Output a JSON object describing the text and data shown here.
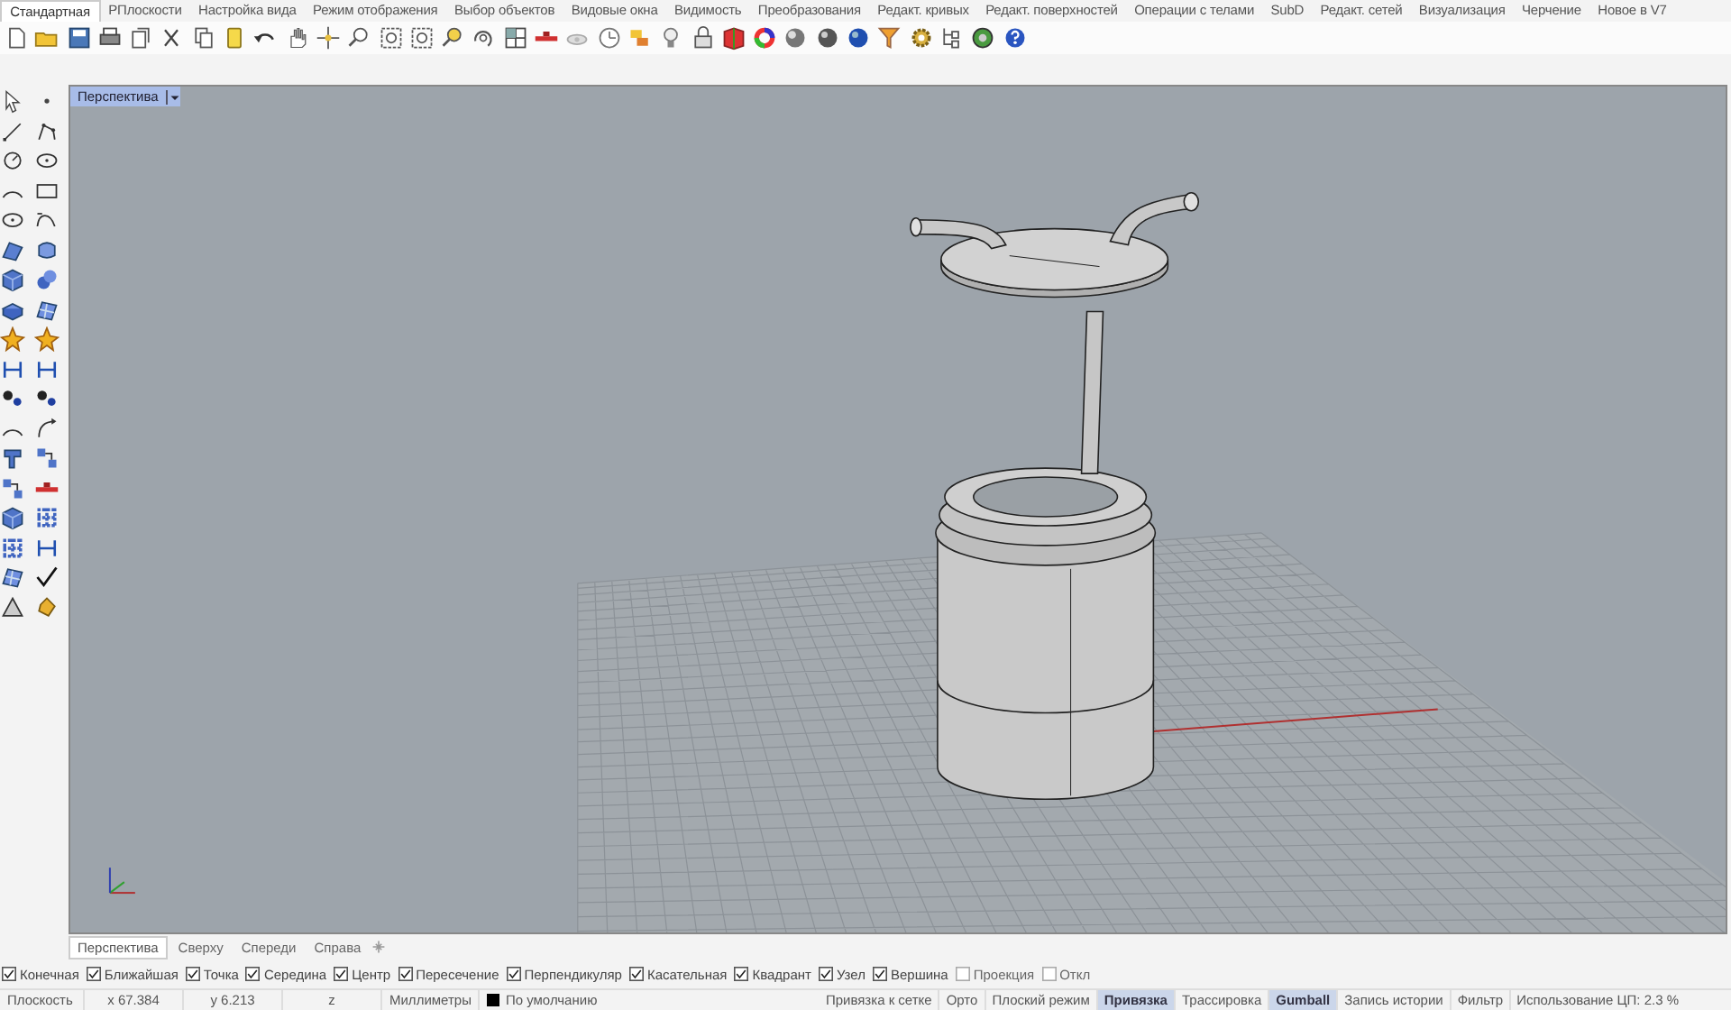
{
  "toolbar_tabs": [
    {
      "label": "Стандартная",
      "selected": true
    },
    {
      "label": "РПлоскости",
      "selected": false
    },
    {
      "label": "Настройка вида",
      "selected": false
    },
    {
      "label": "Режим отображения",
      "selected": false
    },
    {
      "label": "Выбор объектов",
      "selected": false
    },
    {
      "label": "Видовые окна",
      "selected": false
    },
    {
      "label": "Видимость",
      "selected": false
    },
    {
      "label": "Преобразования",
      "selected": false
    },
    {
      "label": "Редакт. кривых",
      "selected": false
    },
    {
      "label": "Редакт. поверхностей",
      "selected": false
    },
    {
      "label": "Операции с телами",
      "selected": false
    },
    {
      "label": "SubD",
      "selected": false
    },
    {
      "label": "Редакт. сетей",
      "selected": false
    },
    {
      "label": "Визуализация",
      "selected": false
    },
    {
      "label": "Черчение",
      "selected": false
    },
    {
      "label": "Новое в V7",
      "selected": false
    }
  ],
  "viewport": {
    "title": "Перспектива"
  },
  "view_tabs": [
    {
      "label": "Перспектива",
      "selected": true
    },
    {
      "label": "Сверху",
      "selected": false
    },
    {
      "label": "Спереди",
      "selected": false
    },
    {
      "label": "Справа",
      "selected": false
    }
  ],
  "osnaps": [
    {
      "label": "Конечная",
      "checked": true
    },
    {
      "label": "Ближайшая",
      "checked": true
    },
    {
      "label": "Точка",
      "checked": true
    },
    {
      "label": "Середина",
      "checked": true
    },
    {
      "label": "Центр",
      "checked": true
    },
    {
      "label": "Пересечение",
      "checked": true
    },
    {
      "label": "Перпендикуляр",
      "checked": true
    },
    {
      "label": "Касательная",
      "checked": true
    },
    {
      "label": "Квадрант",
      "checked": true
    },
    {
      "label": "Узел",
      "checked": true
    },
    {
      "label": "Вершина",
      "checked": true
    },
    {
      "label": "Проекция",
      "checked": false
    },
    {
      "label": "Откл",
      "checked": false
    }
  ],
  "status_bar": {
    "plane": "Плоскость",
    "x": "x 67.384",
    "y": "y 6.213",
    "z": "z",
    "units": "Миллиметры",
    "layer": {
      "name": "По умолчанию",
      "color": "#000000"
    },
    "toggles": [
      {
        "label": "Привязка к сетке",
        "selected": false
      },
      {
        "label": "Орто",
        "selected": false
      },
      {
        "label": "Плоский режим",
        "selected": false
      },
      {
        "label": "Привязка",
        "selected": true
      },
      {
        "label": "Трассировка",
        "selected": false
      },
      {
        "label": "Gumball",
        "selected": true
      },
      {
        "label": "Запись истории",
        "selected": false
      },
      {
        "label": "Фильтр",
        "selected": false
      }
    ],
    "cpu": "Использование ЦП: 2.3 %"
  }
}
